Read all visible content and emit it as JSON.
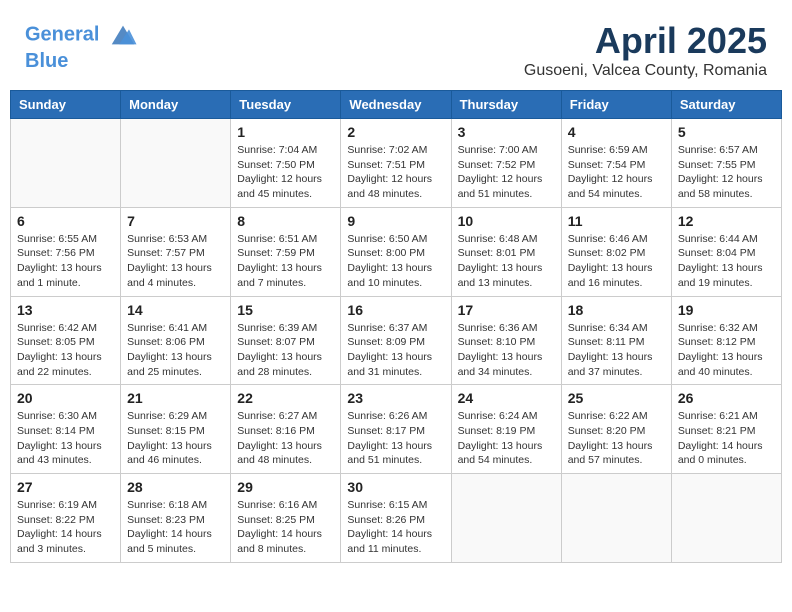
{
  "header": {
    "logo_line1": "General",
    "logo_line2": "Blue",
    "month": "April 2025",
    "location": "Gusoeni, Valcea County, Romania"
  },
  "weekdays": [
    "Sunday",
    "Monday",
    "Tuesday",
    "Wednesday",
    "Thursday",
    "Friday",
    "Saturday"
  ],
  "weeks": [
    [
      {
        "day": "",
        "info": ""
      },
      {
        "day": "",
        "info": ""
      },
      {
        "day": "1",
        "info": "Sunrise: 7:04 AM\nSunset: 7:50 PM\nDaylight: 12 hours and 45 minutes."
      },
      {
        "day": "2",
        "info": "Sunrise: 7:02 AM\nSunset: 7:51 PM\nDaylight: 12 hours and 48 minutes."
      },
      {
        "day": "3",
        "info": "Sunrise: 7:00 AM\nSunset: 7:52 PM\nDaylight: 12 hours and 51 minutes."
      },
      {
        "day": "4",
        "info": "Sunrise: 6:59 AM\nSunset: 7:54 PM\nDaylight: 12 hours and 54 minutes."
      },
      {
        "day": "5",
        "info": "Sunrise: 6:57 AM\nSunset: 7:55 PM\nDaylight: 12 hours and 58 minutes."
      }
    ],
    [
      {
        "day": "6",
        "info": "Sunrise: 6:55 AM\nSunset: 7:56 PM\nDaylight: 13 hours and 1 minute."
      },
      {
        "day": "7",
        "info": "Sunrise: 6:53 AM\nSunset: 7:57 PM\nDaylight: 13 hours and 4 minutes."
      },
      {
        "day": "8",
        "info": "Sunrise: 6:51 AM\nSunset: 7:59 PM\nDaylight: 13 hours and 7 minutes."
      },
      {
        "day": "9",
        "info": "Sunrise: 6:50 AM\nSunset: 8:00 PM\nDaylight: 13 hours and 10 minutes."
      },
      {
        "day": "10",
        "info": "Sunrise: 6:48 AM\nSunset: 8:01 PM\nDaylight: 13 hours and 13 minutes."
      },
      {
        "day": "11",
        "info": "Sunrise: 6:46 AM\nSunset: 8:02 PM\nDaylight: 13 hours and 16 minutes."
      },
      {
        "day": "12",
        "info": "Sunrise: 6:44 AM\nSunset: 8:04 PM\nDaylight: 13 hours and 19 minutes."
      }
    ],
    [
      {
        "day": "13",
        "info": "Sunrise: 6:42 AM\nSunset: 8:05 PM\nDaylight: 13 hours and 22 minutes."
      },
      {
        "day": "14",
        "info": "Sunrise: 6:41 AM\nSunset: 8:06 PM\nDaylight: 13 hours and 25 minutes."
      },
      {
        "day": "15",
        "info": "Sunrise: 6:39 AM\nSunset: 8:07 PM\nDaylight: 13 hours and 28 minutes."
      },
      {
        "day": "16",
        "info": "Sunrise: 6:37 AM\nSunset: 8:09 PM\nDaylight: 13 hours and 31 minutes."
      },
      {
        "day": "17",
        "info": "Sunrise: 6:36 AM\nSunset: 8:10 PM\nDaylight: 13 hours and 34 minutes."
      },
      {
        "day": "18",
        "info": "Sunrise: 6:34 AM\nSunset: 8:11 PM\nDaylight: 13 hours and 37 minutes."
      },
      {
        "day": "19",
        "info": "Sunrise: 6:32 AM\nSunset: 8:12 PM\nDaylight: 13 hours and 40 minutes."
      }
    ],
    [
      {
        "day": "20",
        "info": "Sunrise: 6:30 AM\nSunset: 8:14 PM\nDaylight: 13 hours and 43 minutes."
      },
      {
        "day": "21",
        "info": "Sunrise: 6:29 AM\nSunset: 8:15 PM\nDaylight: 13 hours and 46 minutes."
      },
      {
        "day": "22",
        "info": "Sunrise: 6:27 AM\nSunset: 8:16 PM\nDaylight: 13 hours and 48 minutes."
      },
      {
        "day": "23",
        "info": "Sunrise: 6:26 AM\nSunset: 8:17 PM\nDaylight: 13 hours and 51 minutes."
      },
      {
        "day": "24",
        "info": "Sunrise: 6:24 AM\nSunset: 8:19 PM\nDaylight: 13 hours and 54 minutes."
      },
      {
        "day": "25",
        "info": "Sunrise: 6:22 AM\nSunset: 8:20 PM\nDaylight: 13 hours and 57 minutes."
      },
      {
        "day": "26",
        "info": "Sunrise: 6:21 AM\nSunset: 8:21 PM\nDaylight: 14 hours and 0 minutes."
      }
    ],
    [
      {
        "day": "27",
        "info": "Sunrise: 6:19 AM\nSunset: 8:22 PM\nDaylight: 14 hours and 3 minutes."
      },
      {
        "day": "28",
        "info": "Sunrise: 6:18 AM\nSunset: 8:23 PM\nDaylight: 14 hours and 5 minutes."
      },
      {
        "day": "29",
        "info": "Sunrise: 6:16 AM\nSunset: 8:25 PM\nDaylight: 14 hours and 8 minutes."
      },
      {
        "day": "30",
        "info": "Sunrise: 6:15 AM\nSunset: 8:26 PM\nDaylight: 14 hours and 11 minutes."
      },
      {
        "day": "",
        "info": ""
      },
      {
        "day": "",
        "info": ""
      },
      {
        "day": "",
        "info": ""
      }
    ]
  ]
}
